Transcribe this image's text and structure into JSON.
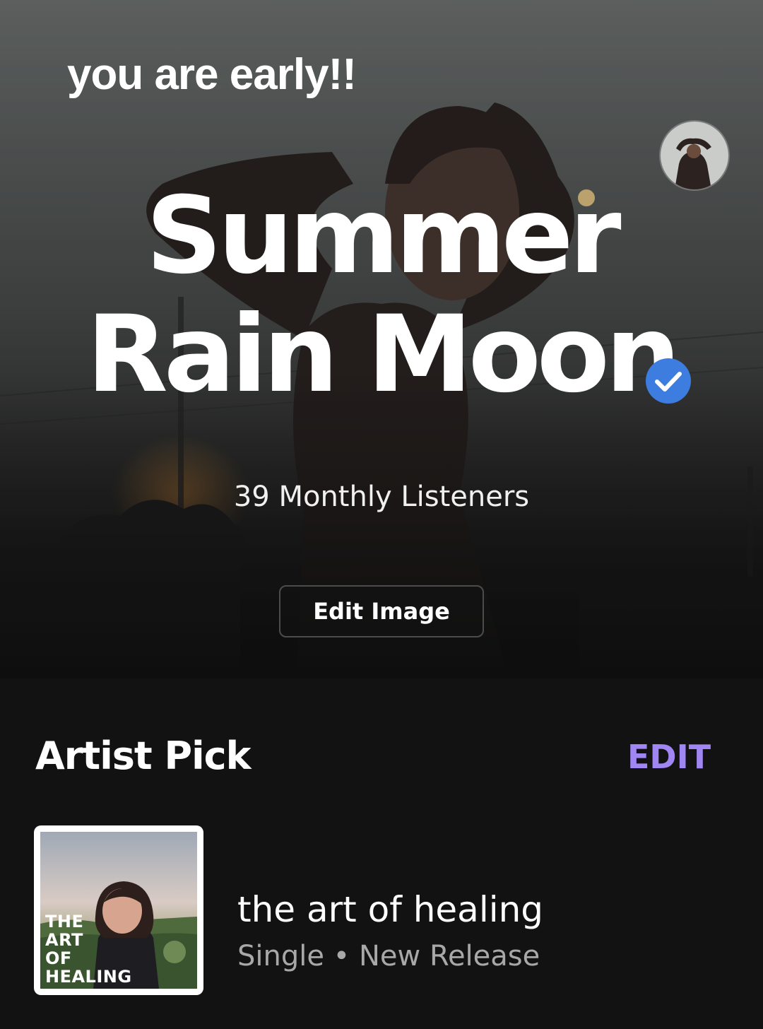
{
  "overlay": {
    "caption": "you are early!!"
  },
  "artist": {
    "name": "Summer Rain Moon",
    "monthly_listeners": "39 Monthly Listeners",
    "verified_icon": "verified-check-icon",
    "edit_image_label": "Edit Image"
  },
  "artist_pick": {
    "section_title": "Artist Pick",
    "edit_label": "EDIT",
    "cover_text": [
      "THE",
      "ART",
      "OF",
      "HEALING"
    ],
    "title": "the art of healing",
    "meta": "Single • New Release"
  },
  "colors": {
    "background": "#121212",
    "accent": "#9f86f2",
    "verified": "#3d7de0",
    "secondary_text": "#a8a8a8"
  }
}
